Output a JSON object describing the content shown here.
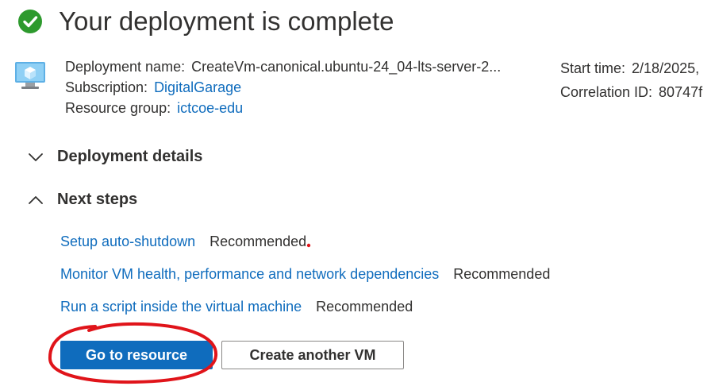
{
  "header": {
    "title": "Your deployment is complete"
  },
  "info": {
    "deployment_name_label": "Deployment name:",
    "deployment_name_value": "CreateVm-canonical.ubuntu-24_04-lts-server-2...",
    "subscription_label": "Subscription:",
    "subscription_value": "DigitalGarage",
    "resource_group_label": "Resource group:",
    "resource_group_value": "ictcoe-edu",
    "start_time_label": "Start time:",
    "start_time_value": "2/18/2025,",
    "correlation_id_label": "Correlation ID:",
    "correlation_id_value": "80747f"
  },
  "sections": {
    "deployment_details": "Deployment details",
    "next_steps": "Next steps"
  },
  "next_steps": [
    {
      "link": "Setup auto-shutdown",
      "tag": "Recommended"
    },
    {
      "link": "Monitor VM health, performance and network dependencies",
      "tag": "Recommended"
    },
    {
      "link": "Run a script inside the virtual machine",
      "tag": "Recommended"
    }
  ],
  "buttons": {
    "go_to_resource": "Go to resource",
    "create_another_vm": "Create another VM"
  },
  "colors": {
    "link": "#0f6cbd",
    "primary_button": "#0f6cbd",
    "success": "#2e9a2e",
    "annotation": "#e0141a"
  }
}
